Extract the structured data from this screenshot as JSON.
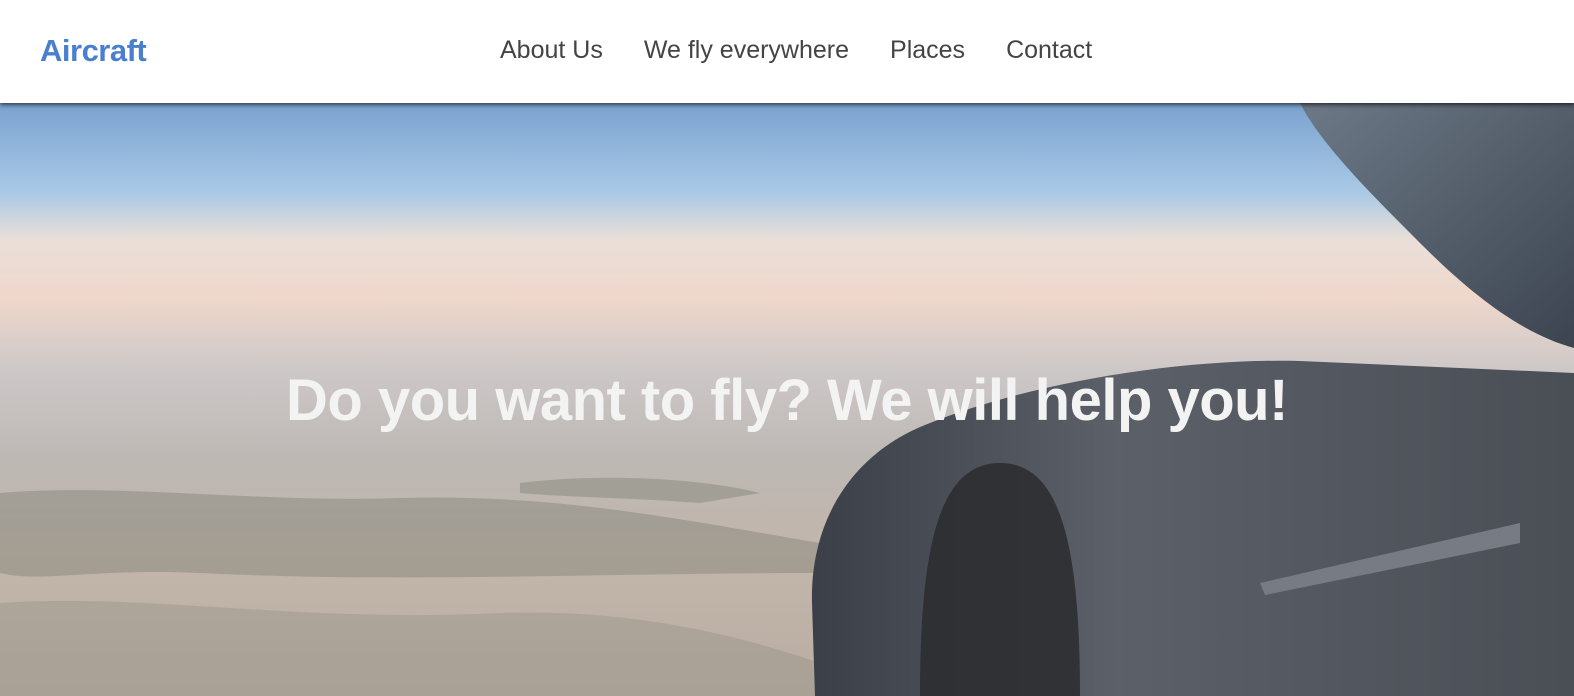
{
  "header": {
    "logo": "Aircraft",
    "nav": [
      "About Us",
      "We fly everywhere",
      "Places",
      "Contact"
    ]
  },
  "hero": {
    "headline": "Do you want to fly? We will help you!",
    "colors": {
      "logo": "#4a7fcf",
      "headline": "#f3f3f3"
    }
  }
}
